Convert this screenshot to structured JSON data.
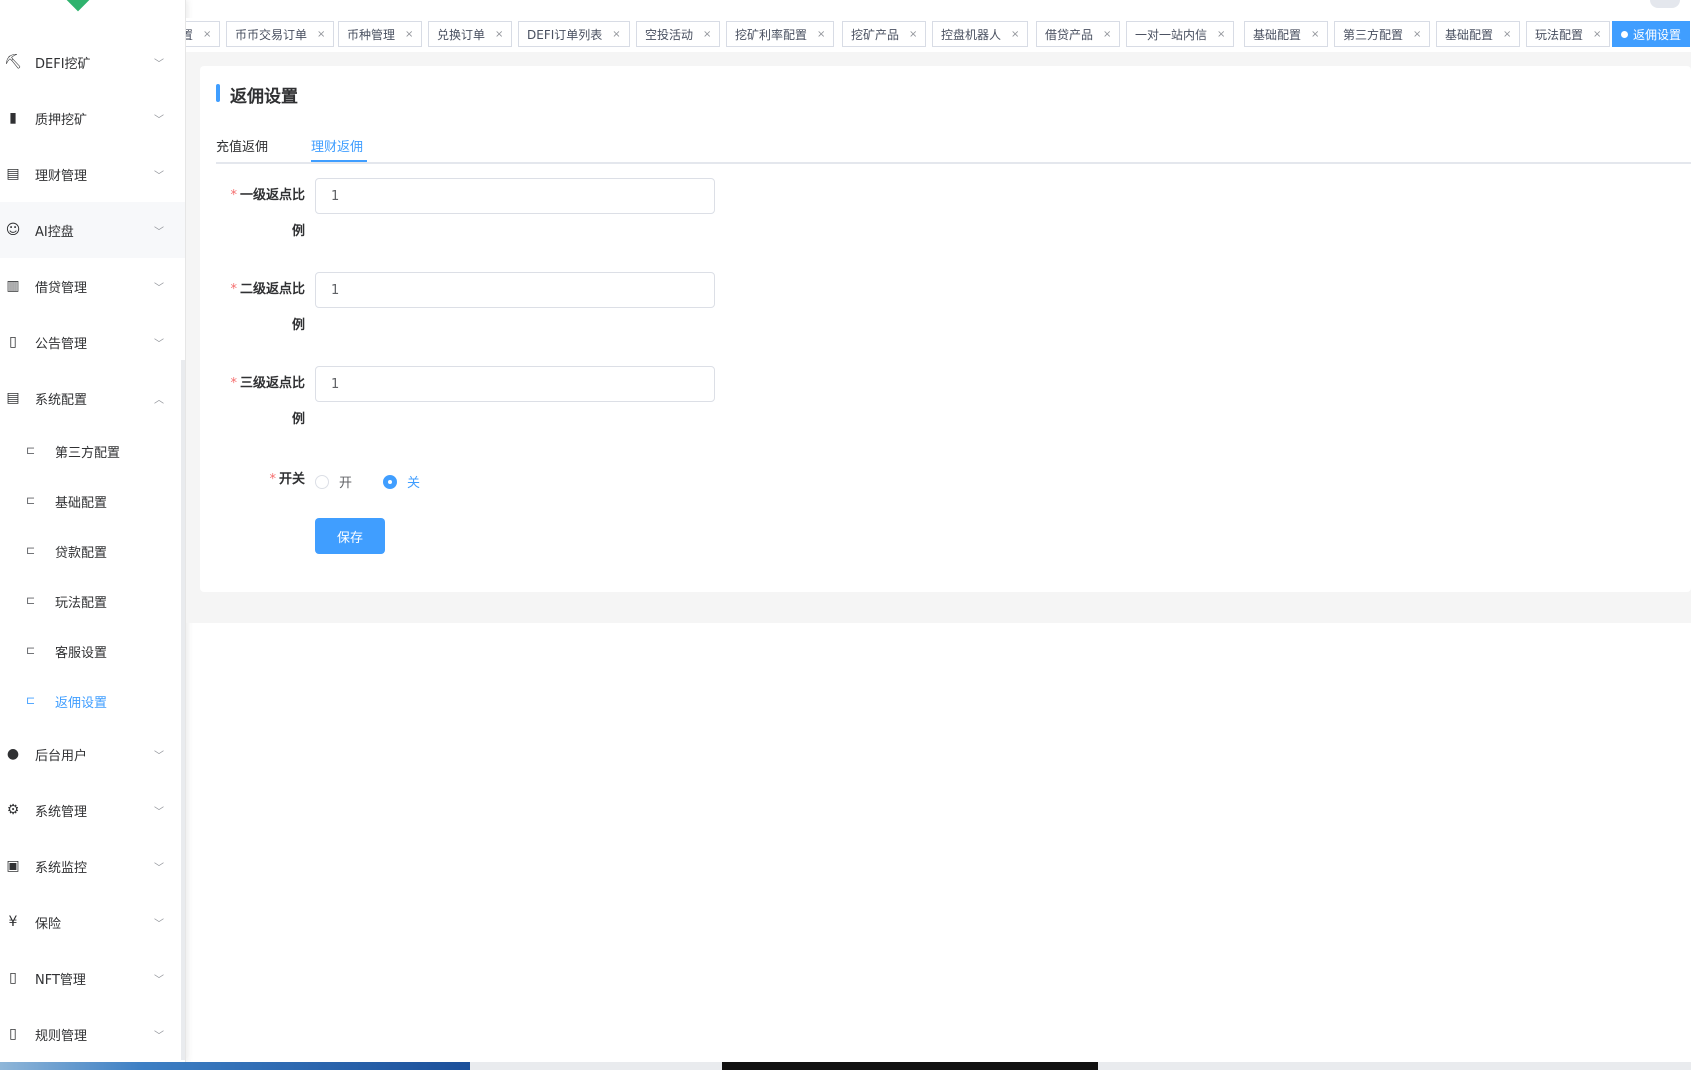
{
  "sidebar": {
    "menu": [
      {
        "label": "DEFI挖矿",
        "icon": "mining-icon",
        "glyph": "⛏"
      },
      {
        "label": "质押挖矿",
        "icon": "bar-chart-icon",
        "glyph": "▮"
      },
      {
        "label": "理财管理",
        "icon": "document-icon",
        "glyph": "▤"
      },
      {
        "label": "AI控盘",
        "icon": "robot-icon",
        "glyph": "☺"
      },
      {
        "label": "借贷管理",
        "icon": "wallet-icon",
        "glyph": "▥"
      },
      {
        "label": "公告管理",
        "icon": "book-icon",
        "glyph": "▯"
      },
      {
        "label": "系统配置",
        "icon": "document-icon",
        "glyph": "▤"
      }
    ],
    "submenu": [
      {
        "label": "第三方配置"
      },
      {
        "label": "基础配置"
      },
      {
        "label": "贷款配置"
      },
      {
        "label": "玩法配置"
      },
      {
        "label": "客服设置"
      },
      {
        "label": "返佣设置"
      }
    ],
    "menu_bottom": [
      {
        "label": "后台用户",
        "icon": "user-icon",
        "glyph": "●"
      },
      {
        "label": "系统管理",
        "icon": "gear-icon",
        "glyph": "⚙"
      },
      {
        "label": "系统监控",
        "icon": "monitor-icon",
        "glyph": "▣"
      },
      {
        "label": "保险",
        "icon": "yen-icon",
        "glyph": "¥"
      },
      {
        "label": "NFT管理",
        "icon": "book-icon",
        "glyph": "▯"
      },
      {
        "label": "规则管理",
        "icon": "book-icon",
        "glyph": "▯"
      }
    ]
  },
  "tags": [
    {
      "label": "置"
    },
    {
      "label": "币币交易订单"
    },
    {
      "label": "币种管理"
    },
    {
      "label": "兑换订单"
    },
    {
      "label": "DEFI订单列表"
    },
    {
      "label": "空投活动"
    },
    {
      "label": "挖矿利率配置"
    },
    {
      "label": "挖矿产品"
    },
    {
      "label": "控盘机器人"
    },
    {
      "label": "借贷产品"
    },
    {
      "label": "一对一站内信"
    },
    {
      "label": "基础配置"
    },
    {
      "label": "第三方配置"
    },
    {
      "label": "基础配置"
    },
    {
      "label": "玩法配置"
    },
    {
      "label": "返佣设置"
    }
  ],
  "page": {
    "title": "返佣设置",
    "tabs": [
      {
        "label": "充值返佣"
      },
      {
        "label": "理财返佣"
      }
    ],
    "form": {
      "level1_label_a": "一级返点比",
      "level1_label_b": "例",
      "level1_value": "1",
      "level2_label_a": "二级返点比",
      "level2_label_b": "例",
      "level2_value": "1",
      "level3_label_a": "三级返点比",
      "level3_label_b": "例",
      "level3_value": "1",
      "switch_label": "开关",
      "switch_on": "开",
      "switch_off": "关",
      "required_mark": "*",
      "save_label": "保存"
    }
  },
  "colors": {
    "accent": "#409eff",
    "required": "#f56c6c"
  }
}
